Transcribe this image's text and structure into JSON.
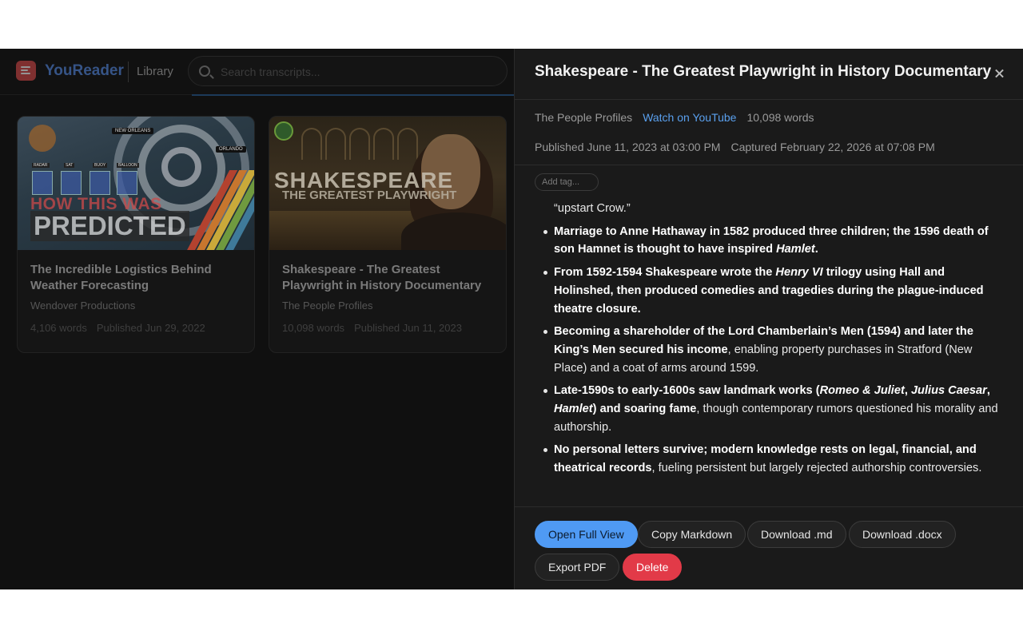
{
  "app": {
    "brand": "YouReader",
    "nav_label": "Library",
    "search_placeholder": "Search transcripts..."
  },
  "cards": [
    {
      "title": "The Incredible Logistics Behind Weather Forecasting",
      "channel": "Wendover Productions",
      "words": "4,106 words",
      "published": "Published Jun 29, 2022",
      "thumb": {
        "line1": "HOW THIS WAS",
        "line2": "PREDICTED",
        "tag_a": "NEW ORLEANS",
        "tag_b": "ORLANDO",
        "sensors": [
          "RADAR",
          "SAT",
          "BUOY",
          "BALLOON"
        ]
      }
    },
    {
      "title": "Shakespeare - The Greatest Playwright in History Documentary",
      "channel": "The People Profiles",
      "words": "10,098 words",
      "published": "Published Jun 11, 2023",
      "thumb": {
        "line1": "SHAKESPEARE",
        "line2": "THE GREATEST PLAYWRIGHT"
      }
    }
  ],
  "detail": {
    "title": "Shakespeare - The Greatest Playwright in History Documentary",
    "channel": "The People Profiles",
    "youtube_link": "Watch on YouTube",
    "word_count": "10,098 words",
    "published": "Published June 11, 2023 at 03:00 PM",
    "captured": "Captured February 22, 2026 at 07:08 PM",
    "tag_placeholder": "Add tag...",
    "lead_text": "“upstart Crow.”",
    "bullets": {
      "b1": "Marriage to Anne Hathaway in 1582 produced three children; the 1596 death of son Hamnet is thought to have inspired ",
      "b1_em": "Hamlet",
      "b1_end": ".",
      "b2_a": "From 1592-1594 Shakespeare wrote the ",
      "b2_em": "Henry VI",
      "b2_b": " trilogy using Hall and Holinshed, then produced comedies and tragedies during the plague-induced theatre closure.",
      "b3_strong": "Becoming a shareholder of the Lord Chamberlain’s Men (1594) and later the King’s Men secured his income",
      "b3_rest": ", enabling property purchases in Stratford (New Place) and a coat of arms around 1599.",
      "b4_a": "Late-1590s to early-1600s saw landmark works (",
      "b4_em1": "Romeo & Juliet",
      "b4_sep1": ", ",
      "b4_em2": "Julius Caesar",
      "b4_sep2": ", ",
      "b4_em3": "Hamlet",
      "b4_b": ") and soaring fame",
      "b4_rest": ", though contemporary rumors questioned his morality and authorship.",
      "b5_strong": "No personal letters survive; modern knowledge rests on legal, financial, and theatrical records",
      "b5_rest": ", fueling persistent but largely rejected authorship controversies."
    },
    "actions": {
      "open_full_view": "Open Full View",
      "copy_markdown": "Copy Markdown",
      "download_md": "Download .md",
      "download_docx": "Download .docx",
      "export_pdf": "Export PDF",
      "delete": "Delete"
    }
  },
  "colors": {
    "accent": "#4f9af4",
    "danger": "#e23a48",
    "brand": "#4a79c6",
    "panel_bg": "#1a1a1a"
  }
}
